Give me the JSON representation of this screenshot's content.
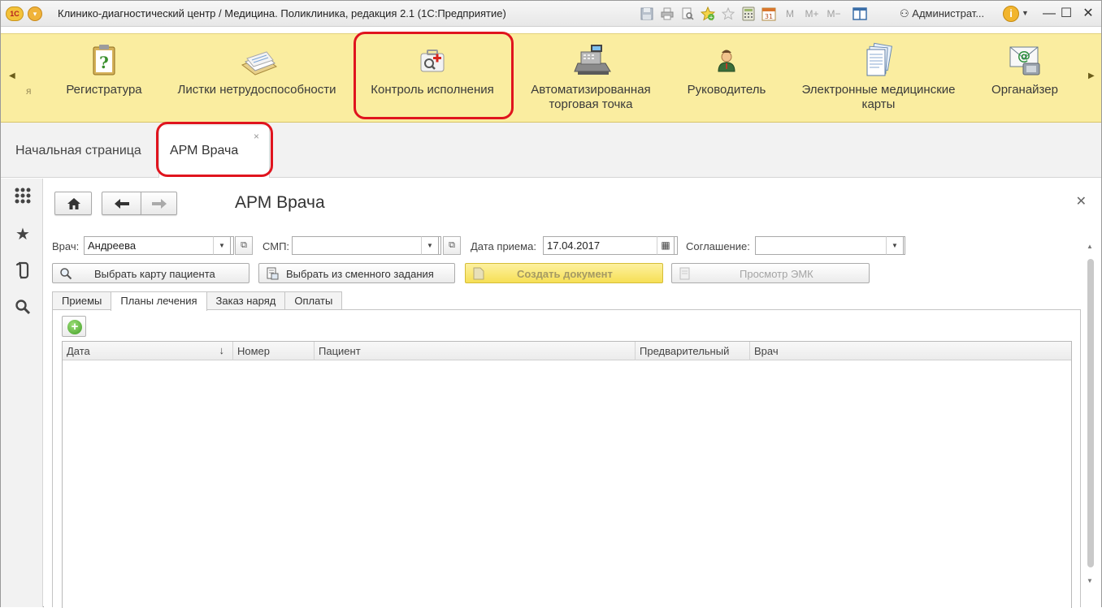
{
  "window": {
    "title": "Клинико-диагностический центр / Медицина. Поликлиника, редакция 2.1  (1С:Предприятие)",
    "logo": "1С",
    "user": "Администрат...",
    "toolbar_icons": [
      "save-icon",
      "print-icon",
      "print-preview-icon",
      "add-favorite-icon",
      "favorites-icon",
      "calculator-icon",
      "calendar-icon",
      "memory-m-icon",
      "memory-plus-icon",
      "memory-minus-icon",
      "panels-icon"
    ],
    "memory_labels": [
      "M",
      "M+",
      "M−"
    ],
    "calendar_day": "31"
  },
  "sections": {
    "partial_left": "я",
    "items": [
      {
        "label": "Регистратура",
        "icon": "clipboard-question-icon"
      },
      {
        "label": "Листки нетрудоспособности",
        "icon": "documents-icon"
      },
      {
        "label": "Контроль исполнения",
        "icon": "medical-kit-icon",
        "highlighted": true
      },
      {
        "label_line1": "Автоматизированная",
        "label_line2": "торговая точка",
        "icon": "cash-register-icon"
      },
      {
        "label": "Руководитель",
        "icon": "manager-icon"
      },
      {
        "label_line1": "Электронные медицинские",
        "label_line2": "карты",
        "icon": "medical-cards-icon"
      },
      {
        "label": "Органайзер",
        "icon": "email-phone-icon"
      }
    ]
  },
  "open_pages": {
    "home": "Начальная страница",
    "active_tab": "АРМ Врача",
    "close_glyph": "×"
  },
  "form": {
    "title": "АРМ Врача",
    "doctor_label": "Врач:",
    "doctor_value": "Андреева",
    "smp_label": "СМП:",
    "smp_value": "",
    "date_label": "Дата приема:",
    "date_value": "17.04.2017",
    "agreement_label": "Соглашение:",
    "agreement_value": "",
    "buttons": {
      "choose_card": "Выбрать карту пациента",
      "choose_shift": "Выбрать из сменного задания",
      "create_doc": "Создать документ",
      "view_emk": "Просмотр ЭМК"
    },
    "tabs": [
      "Приемы",
      "Планы лечения",
      "Заказ наряд",
      "Оплаты"
    ],
    "active_tab_index": 1,
    "table": {
      "columns": [
        "Дата",
        "Номер",
        "Пациент",
        "Предварительный",
        "Врач"
      ],
      "sort_column": "Дата",
      "sort_direction": "desc",
      "rows": []
    }
  },
  "colors": {
    "sections_bg": "#faeda0",
    "highlight": "#e0141e",
    "create_button": "#f6df55"
  }
}
